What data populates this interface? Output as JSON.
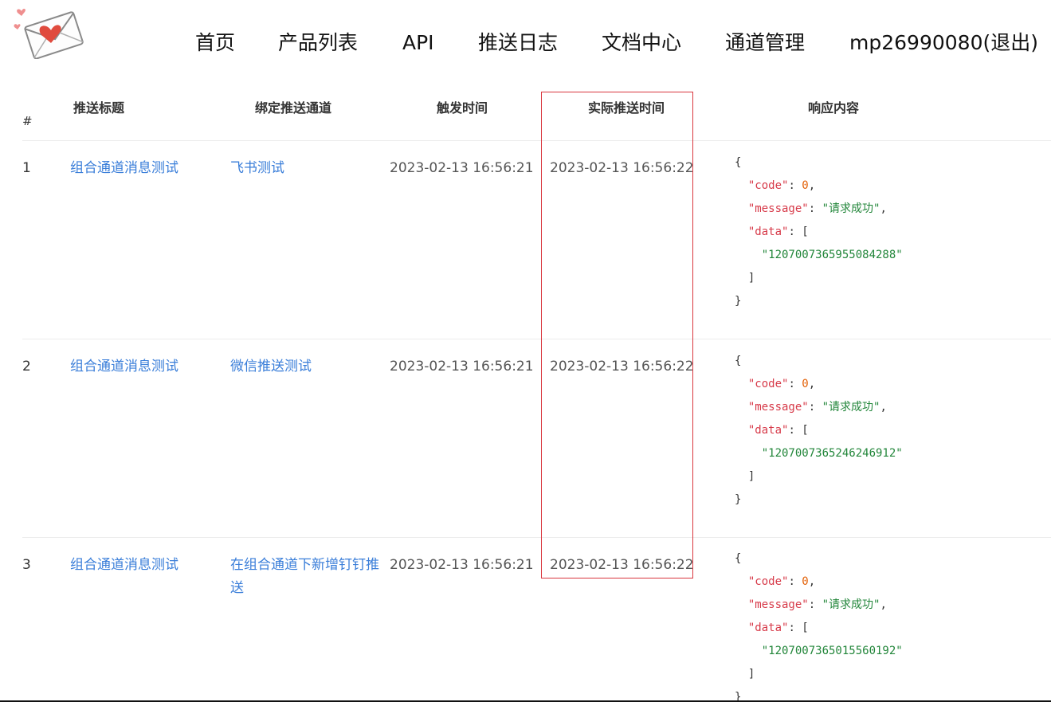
{
  "nav": {
    "items": [
      "首页",
      "产品列表",
      "API",
      "推送日志",
      "文档中心",
      "通道管理",
      "mp26990080(退出)"
    ]
  },
  "table": {
    "headers": {
      "index": "#",
      "title": "推送标题",
      "channel": "绑定推送通道",
      "trigger_time": "触发时间",
      "actual_time": "实际推送时间",
      "response": "响应内容"
    },
    "rows": [
      {
        "index": "1",
        "title": "组合通道消息测试",
        "channel": "飞书测试",
        "trigger_time": "2023-02-13 16:56:21",
        "actual_time": "2023-02-13 16:56:22",
        "response": {
          "open": "{",
          "code_key": "\"code\"",
          "code_val": "0",
          "message_key": "\"message\"",
          "message_val": "\"请求成功\"",
          "data_key": "\"data\"",
          "data_item": "\"1207007365955084288\"",
          "close_arr": "]",
          "close": "}"
        }
      },
      {
        "index": "2",
        "title": "组合通道消息测试",
        "channel": "微信推送测试",
        "trigger_time": "2023-02-13 16:56:21",
        "actual_time": "2023-02-13 16:56:22",
        "response": {
          "open": "{",
          "code_key": "\"code\"",
          "code_val": "0",
          "message_key": "\"message\"",
          "message_val": "\"请求成功\"",
          "data_key": "\"data\"",
          "data_item": "\"1207007365246246912\"",
          "close_arr": "]",
          "close": "}"
        }
      },
      {
        "index": "3",
        "title": "组合通道消息测试",
        "channel": "在组合通道下新增钉钉推送",
        "trigger_time": "2023-02-13 16:56:21",
        "actual_time": "2023-02-13 16:56:22",
        "response": {
          "open": "{",
          "code_key": "\"code\"",
          "code_val": "0",
          "message_key": "\"message\"",
          "message_val": "\"请求成功\"",
          "data_key": "\"data\"",
          "data_item": "\"1207007365015560192\"",
          "close_arr": "]",
          "close": "}"
        }
      }
    ]
  },
  "colors": {
    "link": "#3a7ed9",
    "highlight_border": "#d9363e",
    "json_key": "#d73a49",
    "json_number": "#e36209",
    "json_string": "#22863a"
  },
  "icons": {
    "logo": "love-letter-envelope-icon"
  }
}
